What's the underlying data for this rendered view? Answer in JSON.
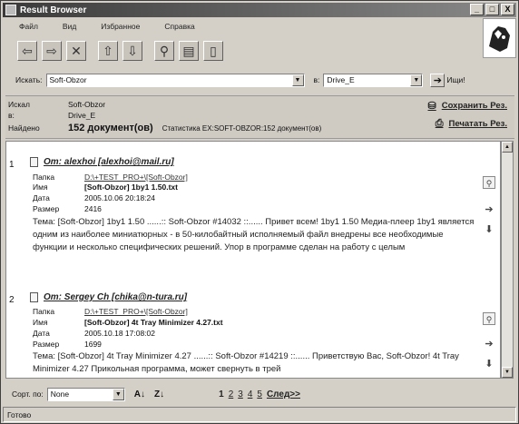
{
  "window": {
    "title": "Result Browser",
    "buttons": [
      "_",
      "□",
      "X"
    ]
  },
  "menu": [
    "Файл",
    "Вид",
    "Избранное",
    "Справка"
  ],
  "search": {
    "label": "Искать:",
    "value": "Soft-Obzor",
    "in_label": "в:",
    "location": "Drive_E",
    "go_label": "Ищи!"
  },
  "info": {
    "searched_label": "Искал",
    "searched_value": "Soft-Obzor",
    "in_label": "в:",
    "in_value": "Drive_E",
    "found_label": "Найдено",
    "found_value": "152 документ(ов)",
    "stats": "Статистика EX:SOFT-OBZOR:152 документ(ов)",
    "save_link": "Сохранить Рез.",
    "print_link": "Печатать Рез."
  },
  "results": [
    {
      "num": "1",
      "title": "От: alexhoi [alexhoi@mail.ru]",
      "fields": [
        {
          "k": "Папка",
          "v": "D:\\+TEST_PRO+\\[Soft-Obzor]",
          "style": "link"
        },
        {
          "k": "Имя",
          "v": "[Soft-Obzor] 1by1 1.50.txt",
          "style": "bold"
        },
        {
          "k": "Дата",
          "v": "2005.10.06  20:18:24",
          "style": ""
        },
        {
          "k": "Размер",
          "v": "2416",
          "style": ""
        }
      ],
      "text": "Тема: [Soft-Obzor] 1by1 1.50 ......:: Soft-Obzor #14032 ::...... Привет всем! 1by1 1.50 Медиа-плеер 1by1 является одним из наиболее миниатюрных - в 50-килобайтный исполняемый файл внедрены все необходимые функции и несколько специфических решений. Упор в программе сделан на работу с целым"
    },
    {
      "num": "2",
      "title": "От: Sergey Ch [chika@n-tura.ru]",
      "fields": [
        {
          "k": "Папка",
          "v": "D:\\+TEST_PRO+\\[Soft-Obzor]",
          "style": "link"
        },
        {
          "k": "Имя",
          "v": "[Soft-Obzor] 4t Tray Minimizer 4.27.txt",
          "style": "bold"
        },
        {
          "k": "Дата",
          "v": "2005.10.18  17:08:02",
          "style": ""
        },
        {
          "k": "Размер",
          "v": "1699",
          "style": ""
        }
      ],
      "text": "Тема: [Soft-Obzor] 4t Tray Minimizer 4.27 ......:: Soft-Obzor #14219 ::...... Приветствую Вас, Soft-Obzor! 4t Tray Minimizer 4.27 Прикольная программа, может свернуть в трей"
    }
  ],
  "bottom": {
    "sort_label": "Сорт. по:",
    "sort_value": "None",
    "asc_label": "A↓",
    "desc_label": "Z↓",
    "pages": [
      "1",
      "2",
      "3",
      "4",
      "5"
    ],
    "next_label": "След>>"
  },
  "status": "Готово",
  "icons": {
    "toolbar": [
      "back-arrow-icon",
      "forward-arrow-icon",
      "stop-x-icon",
      "up-arrow-icon",
      "down-arrow-icon",
      "search-icon",
      "print-icon",
      "clipboard-icon"
    ]
  }
}
